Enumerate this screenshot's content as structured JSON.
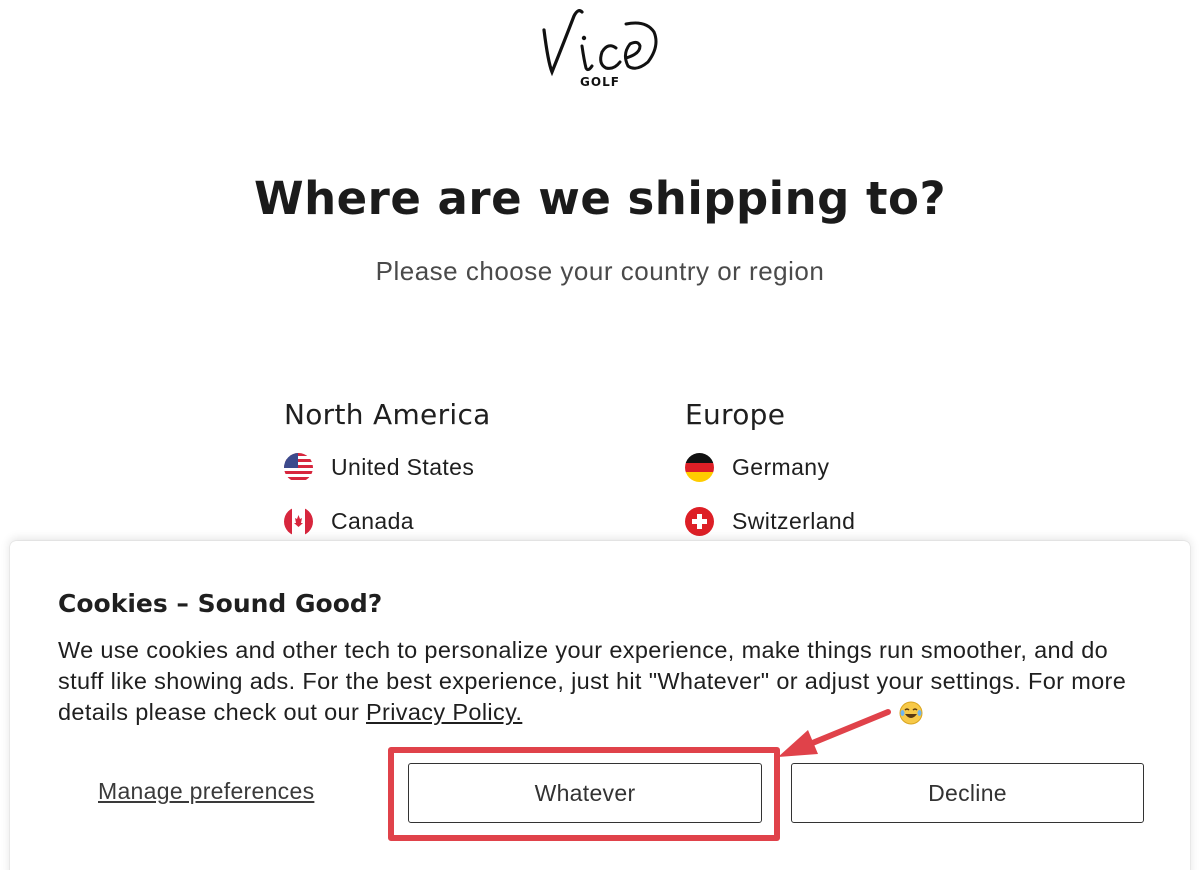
{
  "brand": {
    "logo_text": "Vice",
    "logo_sub": "GOLF"
  },
  "headline": "Where are we shipping to?",
  "subheadline": "Please choose your country or region",
  "regions": [
    {
      "title": "North America",
      "countries": [
        "United States",
        "Canada"
      ]
    },
    {
      "title": "Europe",
      "countries": [
        "Germany",
        "Switzerland"
      ]
    }
  ],
  "cookie_banner": {
    "title": "Cookies – Sound Good?",
    "body": "We use cookies and other tech to personalize your experience, make things run smoother, and do stuff like showing ads. For the best experience, just hit \"Whatever\" or adjust your settings. For more details please check out our",
    "privacy_link": "Privacy Policy.",
    "emoji": "laughing-crying-emoji",
    "manage_label": "Manage preferences",
    "accept_label": "Whatever",
    "decline_label": "Decline"
  },
  "annotation": {
    "highlight_color": "#e0424a"
  }
}
